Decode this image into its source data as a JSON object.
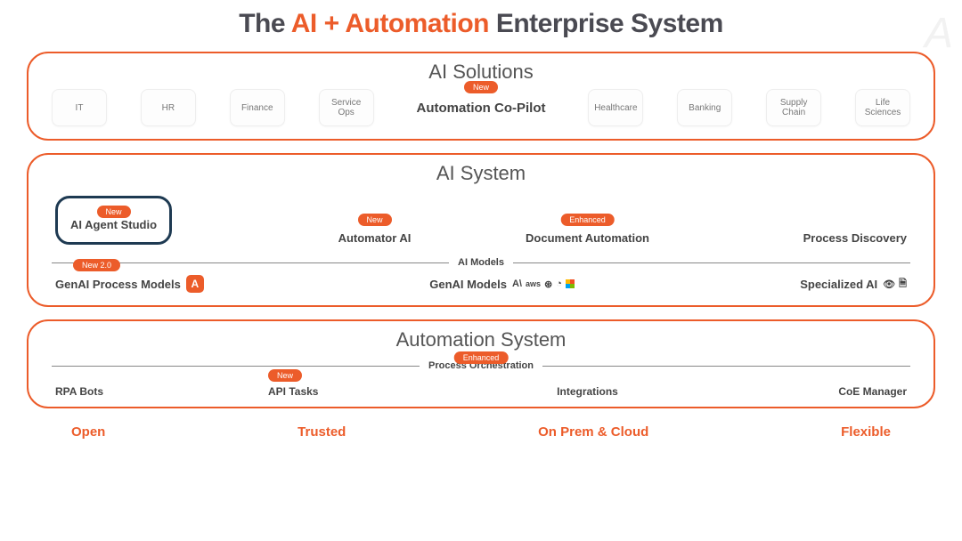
{
  "title": {
    "prefix": "The ",
    "accent": "AI + Automation",
    "suffix": " Enterprise System"
  },
  "watermark": "A",
  "solutions": {
    "title": "AI Solutions",
    "center_badge": "New",
    "center_label": "Automation Co-Pilot",
    "left_chips": [
      "IT",
      "HR",
      "Finance",
      "Service Ops"
    ],
    "right_chips": [
      "Healthcare",
      "Banking",
      "Supply Chain",
      "Life Sciences"
    ]
  },
  "ai_system": {
    "title": "AI System",
    "cells": [
      {
        "label": "AI Agent Studio",
        "badge": "New",
        "highlighted": true
      },
      {
        "label": "Automator AI",
        "badge": "New"
      },
      {
        "label": "Document Automation",
        "badge": "Enhanced"
      },
      {
        "label": "Process Discovery",
        "badge": null
      }
    ],
    "divider_label": "AI Models",
    "models": [
      {
        "label": "GenAI Process Models",
        "badge": "New 2.0",
        "has_logo": true
      },
      {
        "label": "GenAI Models",
        "badge": null,
        "has_partner_icons": true
      },
      {
        "label": "Specialized AI",
        "badge": null,
        "has_spec_icons": true
      }
    ],
    "partner_icons_alt": "Anthropic, AWS, OpenAI, Google, Microsoft"
  },
  "automation": {
    "title": "Automation System",
    "divider_label": "Process Orchestration",
    "divider_badge": "Enhanced",
    "cells": [
      {
        "label": "RPA Bots",
        "badge": null
      },
      {
        "label": "API Tasks",
        "badge": "New"
      },
      {
        "label": "Integrations",
        "badge": null
      },
      {
        "label": "CoE Manager",
        "badge": null
      }
    ]
  },
  "footer": [
    "Open",
    "Trusted",
    "On Prem & Cloud",
    "Flexible"
  ]
}
